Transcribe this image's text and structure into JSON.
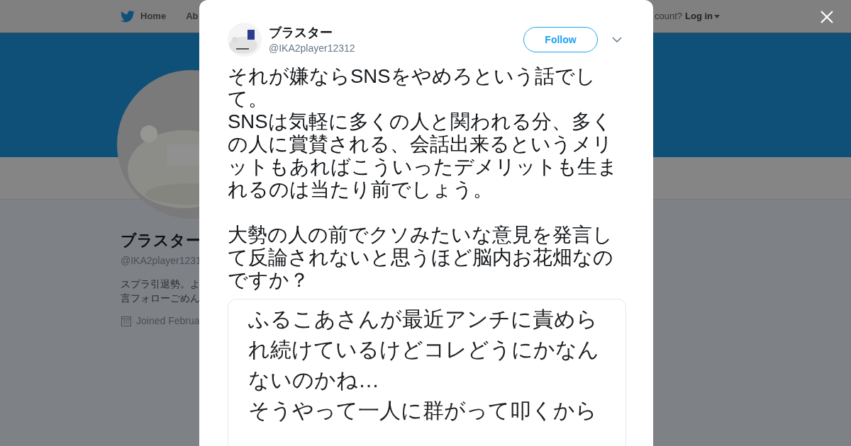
{
  "background_page": {
    "nav": {
      "items": [
        "Home",
        "Ab"
      ],
      "account_prompt": "count?",
      "login": "Log in"
    },
    "profile": {
      "name": "ブラスター",
      "handle": "@IKA2player1231",
      "bio": [
        "スプラ引退勢。よ",
        "言フォローごめん"
      ],
      "joined": "Joined Februa"
    }
  },
  "tweet": {
    "author": {
      "name": "ブラスター",
      "handle": "@IKA2player12312"
    },
    "follow_button": "Follow",
    "text_paragraphs": [
      "それが嫌ならSNSをやめろという話でして。",
      "SNSは気軽に多くの人と関われる分、多くの人に賞賛される、会話出来るというメリットもあればこういったデメリットも生まれるのは当たり前でしょう。",
      "大勢の人の前でクソみたいな意見を発言して反論されないと思うほど脳内お花畑なのですか？"
    ],
    "attached_image_lines": [
      "ふるこあさんが最近アンチに責めら",
      "れ続けているけどコレどうにかなん",
      "ないのかね…",
      "そうやって一人に群がって叩くから"
    ]
  }
}
